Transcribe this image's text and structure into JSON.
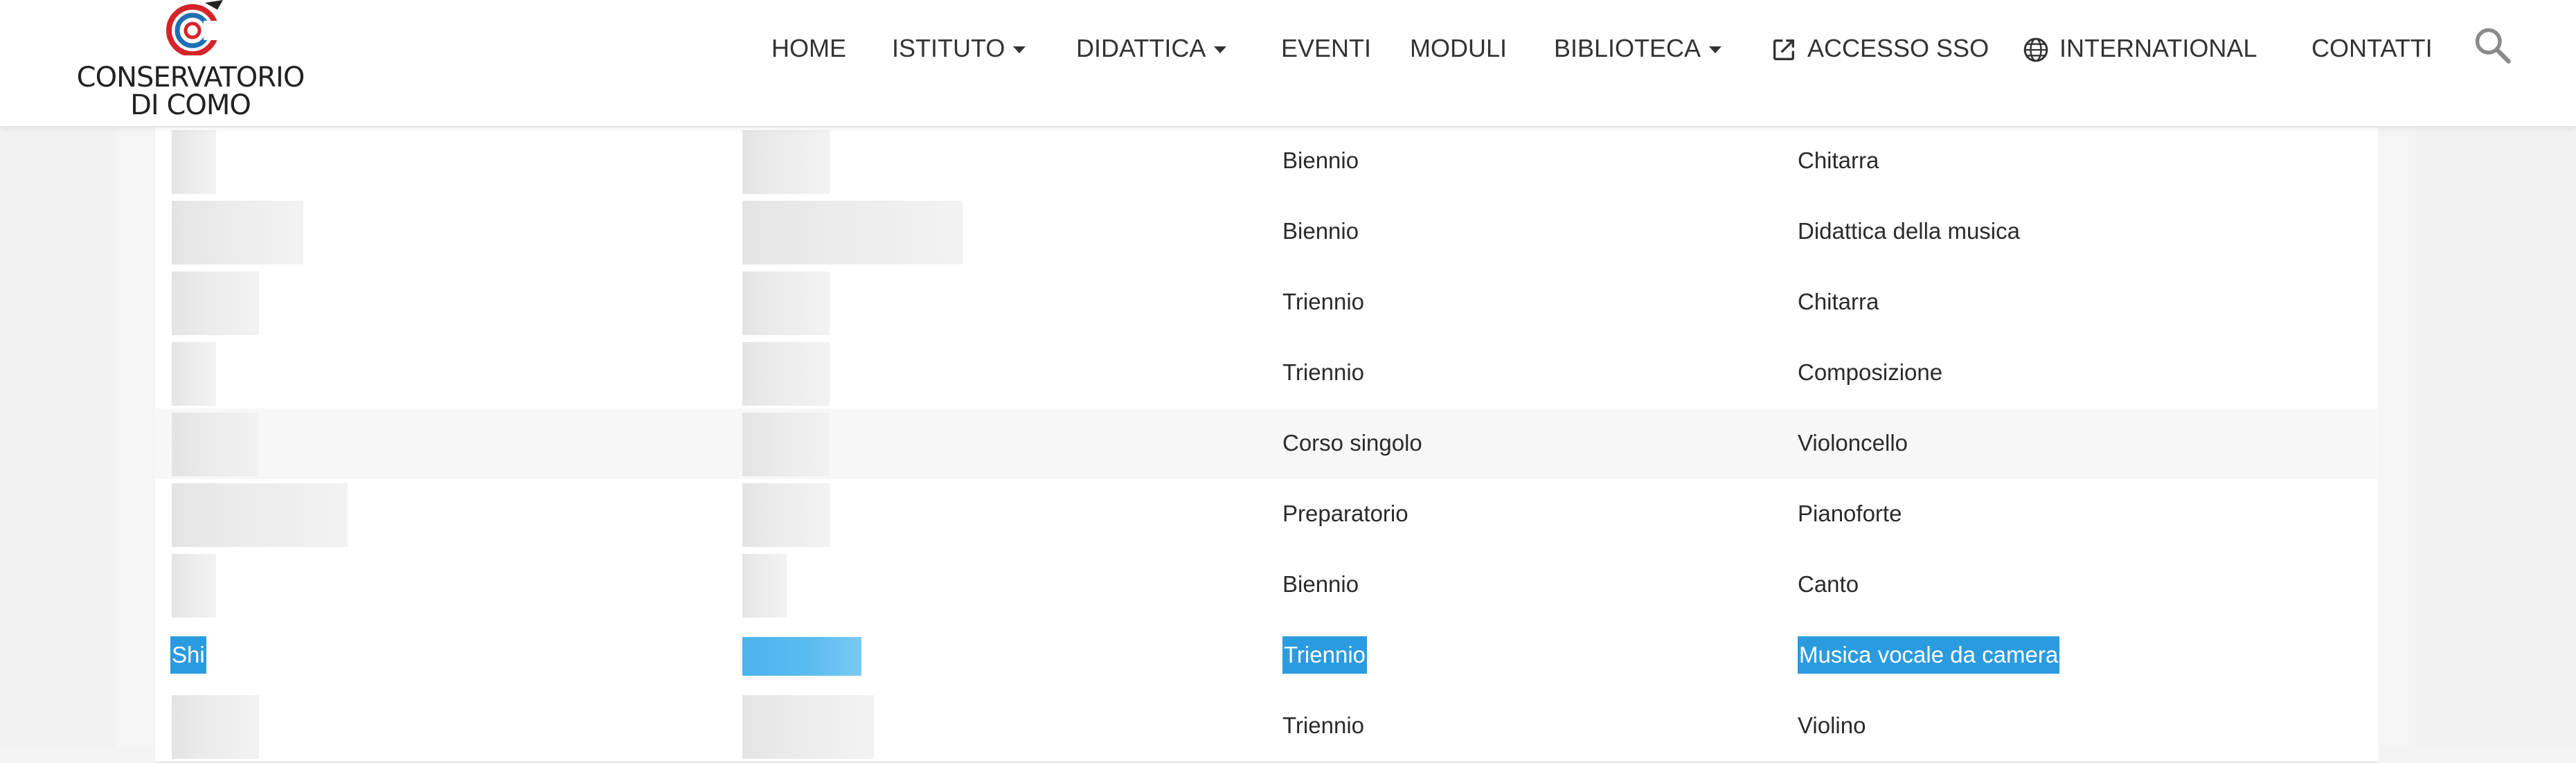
{
  "header": {
    "logo": {
      "line1": "CONSERVATORIO",
      "line2": "DI COMO"
    },
    "nav": [
      {
        "label": "HOME",
        "caret": false
      },
      {
        "label": "ISTITUTO",
        "caret": true
      },
      {
        "label": "DIDATTICA",
        "caret": true
      },
      {
        "label": "EVENTI",
        "caret": false
      },
      {
        "label": "MODULI",
        "caret": false
      },
      {
        "label": "BIBLIOTECA",
        "caret": true
      },
      {
        "label": "ACCESSO SSO",
        "icon": "external-link-icon"
      },
      {
        "label": "INTERNATIONAL",
        "icon": "globe-icon"
      },
      {
        "label": "CONTATTI",
        "caret": false
      }
    ],
    "search_icon": "search-icon"
  },
  "table": {
    "rows": [
      {
        "level": "Biennio",
        "instrument": "Chitarra"
      },
      {
        "level": "Biennio",
        "instrument": "Didattica della musica"
      },
      {
        "level": "Triennio",
        "instrument": "Chitarra"
      },
      {
        "level": "Triennio",
        "instrument": "Composizione"
      },
      {
        "level": "Corso singolo",
        "instrument": "Violoncello"
      },
      {
        "level": "Preparatorio",
        "instrument": "Pianoforte"
      },
      {
        "level": "Biennio",
        "instrument": "Canto"
      },
      {
        "name": "Shi",
        "level": "Triennio",
        "instrument": "Musica vocale da camera",
        "selected": true
      },
      {
        "level": "Triennio",
        "instrument": "Violino"
      }
    ]
  },
  "colors": {
    "selection": "#2b9be0",
    "text": "#2b2b2b",
    "logo_red": "#d6232a",
    "logo_blue": "#1f6fb5"
  }
}
